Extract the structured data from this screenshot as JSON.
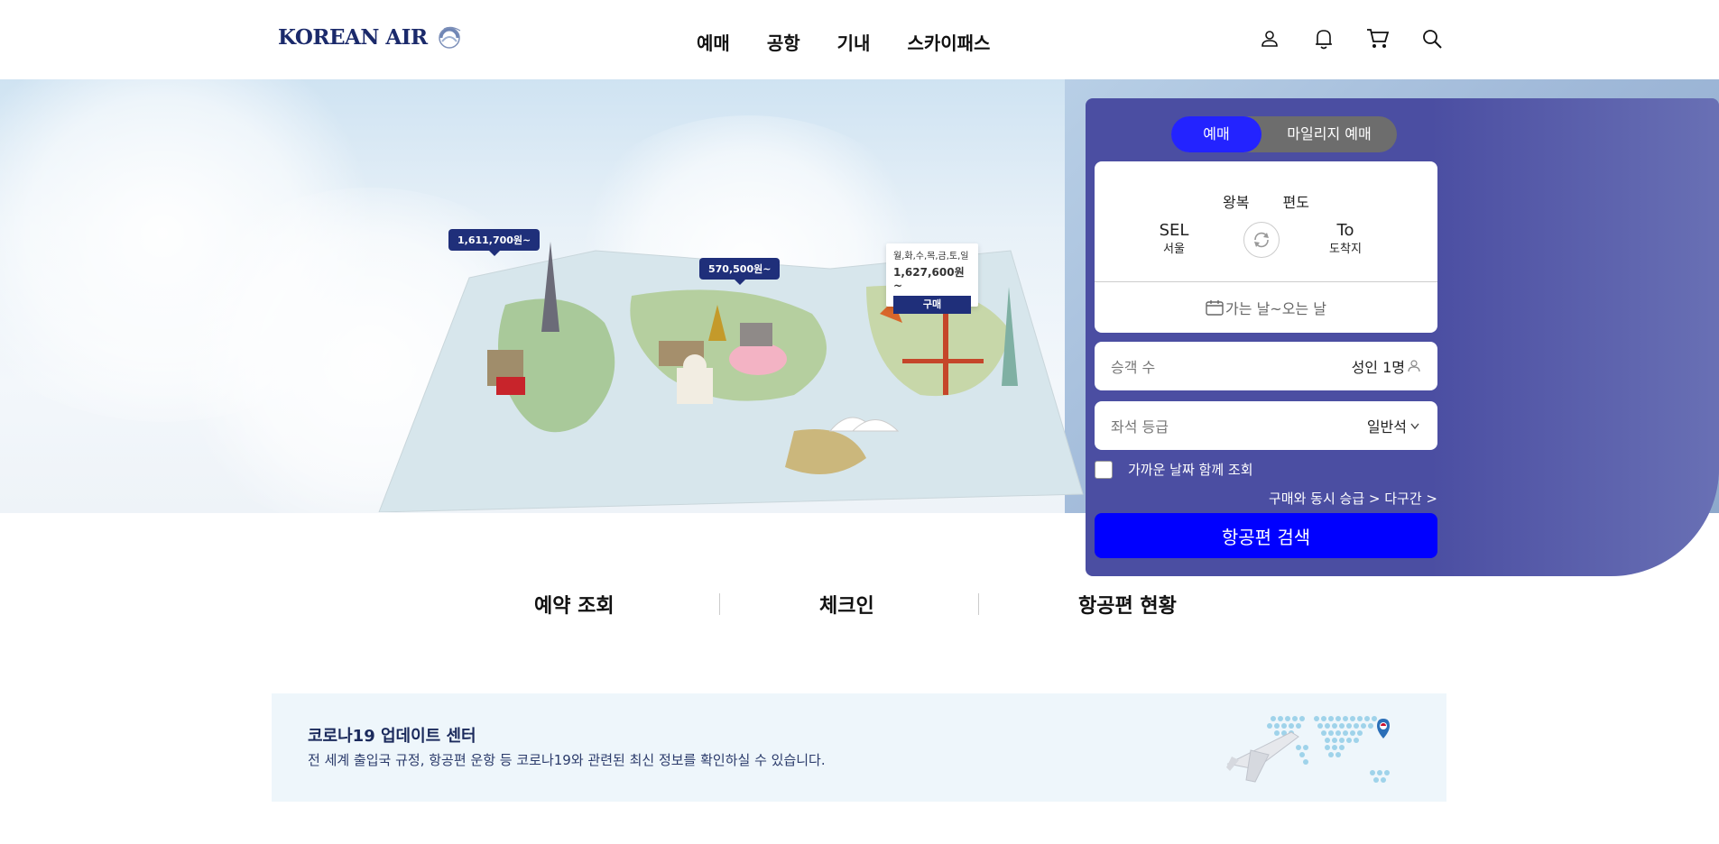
{
  "header": {
    "logo_text": "KOREAN AIR",
    "nav": [
      "예매",
      "공항",
      "기내",
      "스카이패스"
    ],
    "icons": [
      "user-icon",
      "bell-icon",
      "cart-icon",
      "search-icon"
    ]
  },
  "hero": {
    "price_tags": [
      "1,611,700원~",
      "570,500원~"
    ],
    "special": {
      "days": "월,화,수,목,금,토,일",
      "price": "1,627,600원~",
      "buy": "구매"
    }
  },
  "booking": {
    "tabs": [
      "예매",
      "마일리지 예매"
    ],
    "trip_types": [
      "왕복",
      "편도"
    ],
    "origin": {
      "code": "SEL",
      "city": "서울"
    },
    "destination": {
      "code": "To",
      "city": "도착지"
    },
    "date_placeholder": "가는 날~오는 날",
    "passengers_label": "승객 수",
    "passengers_value": "성인 1명",
    "class_label": "좌석 등급",
    "class_value": "일반석",
    "nearby_label": "가까운 날짜 함께 조회",
    "upgrade_link": "구매와 동시 승급 >",
    "multi_link": "다구간 >",
    "search_button": "항공편 검색"
  },
  "quick_links": [
    "예약 조회",
    "체크인",
    "항공편 현황"
  ],
  "covid": {
    "title": "코로나19 업데이트 센터",
    "desc": "전 세계 출입국 규정, 항공편 운항 등 코로나19와 관련된 최신 정보를 확인하실 수 있습니다."
  },
  "colors": {
    "brand_navy": "#1b2a6b",
    "panel": "#4b4ea2",
    "search_blue": "#0000ff",
    "active_tab": "#2323ff"
  }
}
